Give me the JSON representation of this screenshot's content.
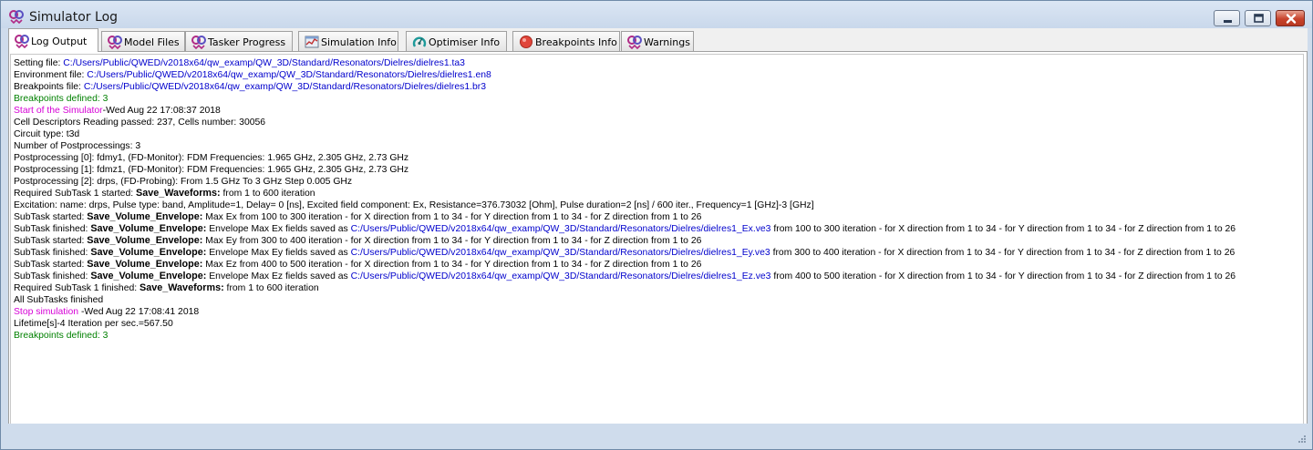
{
  "window": {
    "title": "Simulator Log",
    "icon": "qw-app-icon",
    "controls": [
      "minimize-icon",
      "maximize-icon",
      "close-icon"
    ]
  },
  "tabs": [
    {
      "label": "Log Output",
      "icon": "qw-icon",
      "active": true
    },
    {
      "label": "Model Files",
      "icon": "qw-icon",
      "active": false
    },
    {
      "label": "Tasker Progress",
      "icon": "qw-icon",
      "active": false
    },
    {
      "label": "Simulation Info",
      "icon": "simulation-info-icon",
      "active": false
    },
    {
      "label": "Optimiser Info",
      "icon": "optimiser-icon",
      "active": false
    },
    {
      "label": "Breakpoints Info",
      "icon": "breakpoint-icon",
      "active": false
    },
    {
      "label": "Warnings",
      "icon": "qw-icon",
      "active": false
    }
  ],
  "colors": {
    "path": "#0000cc",
    "breakpoints": "#008000",
    "simulator_event": "#d600d6"
  },
  "log": {
    "setting_file": {
      "label": "Setting file: ",
      "path": "C:/Users/Public/QWED/v2018x64/qw_examp/QW_3D/Standard/Resonators/Dielres/dielres1.ta3"
    },
    "environment_file": {
      "label": "Environment file: ",
      "path": "C:/Users/Public/QWED/v2018x64/qw_examp/QW_3D/Standard/Resonators/Dielres/dielres1.en8"
    },
    "breakpoints_file": {
      "label": "Breakpoints file: ",
      "path": "C:/Users/Public/QWED/v2018x64/qw_examp/QW_3D/Standard/Resonators/Dielres/dielres1.br3"
    },
    "breakpoints_defined_1": "Breakpoints defined: 3",
    "start": {
      "label": "Start of the Simulator",
      "text": "-Wed Aug 22 17:08:37 2018"
    },
    "cell_descriptors": "Cell Descriptors Reading passed: 237, Cells number: 30056",
    "circuit_type": "Circuit type: t3d",
    "num_postprocessings": "Number of Postprocessings: 3",
    "postprocessing_0": "Postprocessing [0]: fdmy1, (FD-Monitor): FDM Frequencies: 1.965 GHz, 2.305 GHz, 2.73 GHz",
    "postprocessing_1": "Postprocessing [1]: fdmz1, (FD-Monitor): FDM Frequencies: 1.965 GHz, 2.305 GHz, 2.73 GHz",
    "postprocessing_2": "Postprocessing [2]: drps, (FD-Probing): From 1.5 GHz To 3 GHz Step 0.005 GHz",
    "required_started": {
      "prefix": "Required SubTask 1 started: ",
      "task": "Save_Waveforms:",
      "suffix": " from 1 to 600 iteration"
    },
    "excitation": "Excitation: name: drps, Pulse type: band, Amplitude=1, Delay= 0 [ns], Excited field component: Ex, Resistance=376.73032 [Ohm], Pulse duration=2 [ns] / 600 iter., Frequency=1 [GHz]-3 [GHz]",
    "subtask_ex_started": {
      "prefix": "SubTask started: ",
      "task": "Save_Volume_Envelope:",
      "suffix": " Max Ex from 100 to 300 iteration - for X direction from 1 to 34 - for Y direction from 1 to 34 - for Z direction from 1 to 26"
    },
    "subtask_ex_finished": {
      "prefix": "SubTask finished: ",
      "task": "Save_Volume_Envelope:",
      "middle": " Envelope Max Ex fields saved as ",
      "path": "C:/Users/Public/QWED/v2018x64/qw_examp/QW_3D/Standard/Resonators/Dielres/dielres1_Ex.ve3",
      "suffix": " from 100 to 300 iteration - for X direction from 1 to 34 - for Y direction from 1 to 34 - for Z direction from 1 to 26"
    },
    "subtask_ey_started": {
      "prefix": "SubTask started: ",
      "task": "Save_Volume_Envelope:",
      "suffix": " Max Ey from 300 to 400 iteration - for X direction from 1 to 34 - for Y direction from 1 to 34 - for Z direction from 1 to 26"
    },
    "subtask_ey_finished": {
      "prefix": "SubTask finished: ",
      "task": "Save_Volume_Envelope:",
      "middle": " Envelope Max Ey fields saved as ",
      "path": "C:/Users/Public/QWED/v2018x64/qw_examp/QW_3D/Standard/Resonators/Dielres/dielres1_Ey.ve3",
      "suffix": " from 300 to 400 iteration - for X direction from 1 to 34 - for Y direction from 1 to 34 - for Z direction from 1 to 26"
    },
    "subtask_ez_started": {
      "prefix": "SubTask started: ",
      "task": "Save_Volume_Envelope:",
      "suffix": " Max Ez from 400 to 500 iteration - for X direction from 1 to 34 - for Y direction from 1 to 34 - for Z direction from 1 to 26"
    },
    "subtask_ez_finished": {
      "prefix": "SubTask finished: ",
      "task": "Save_Volume_Envelope:",
      "middle": " Envelope Max Ez fields saved as ",
      "path": "C:/Users/Public/QWED/v2018x64/qw_examp/QW_3D/Standard/Resonators/Dielres/dielres1_Ez.ve3",
      "suffix": " from 400 to 500 iteration - for X direction from 1 to 34 - for Y direction from 1 to 34 - for Z direction from 1 to 26"
    },
    "required_finished": {
      "prefix": "Required SubTask 1 finished: ",
      "task": "Save_Waveforms:",
      "suffix": " from 1 to 600 iteration"
    },
    "all_subtasks": "All SubTasks finished",
    "stop": {
      "label": "Stop simulation ",
      "text": "-Wed Aug 22 17:08:41 2018"
    },
    "lifetime": "Lifetime[s]-4 Iteration per sec.=567.50",
    "breakpoints_defined_2": "Breakpoints defined: 3"
  }
}
